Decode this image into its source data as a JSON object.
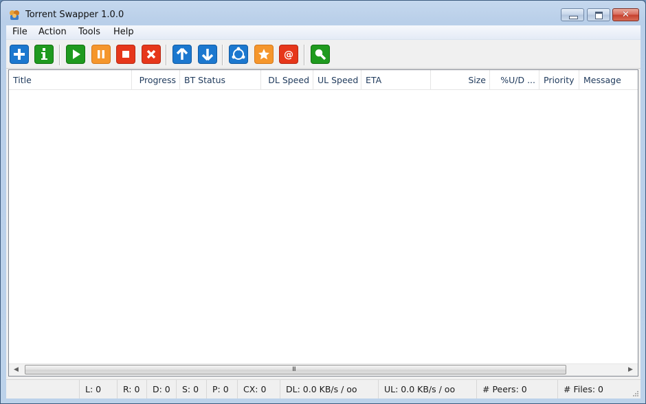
{
  "window": {
    "title": "Torrent Swapper 1.0.0",
    "controls": {
      "minimize": "minimize",
      "maximize": "maximize",
      "close": "✕"
    }
  },
  "menu": [
    {
      "label": "File"
    },
    {
      "label": "Action"
    },
    {
      "label": "Tools"
    },
    {
      "label": "Help"
    }
  ],
  "toolbar": {
    "buttons": [
      {
        "name": "add-torrent",
        "icon": "plus-icon",
        "color": "#1c78cf"
      },
      {
        "name": "info",
        "icon": "info-icon",
        "color": "#1f9a1f"
      },
      {
        "name": "start",
        "icon": "play-icon",
        "color": "#1f9a1f"
      },
      {
        "name": "pause",
        "icon": "pause-icon",
        "color": "#f5962c"
      },
      {
        "name": "stop",
        "icon": "stop-icon",
        "color": "#e6371b"
      },
      {
        "name": "remove",
        "icon": "x-icon",
        "color": "#e6371b"
      },
      {
        "name": "move-up",
        "icon": "arrow-up-icon",
        "color": "#1c78cf"
      },
      {
        "name": "move-down",
        "icon": "arrow-down-icon",
        "color": "#1c78cf"
      },
      {
        "name": "share",
        "icon": "share-icon",
        "color": "#1c78cf"
      },
      {
        "name": "favorite",
        "icon": "star-icon",
        "color": "#f5962c"
      },
      {
        "name": "email",
        "icon": "at-icon",
        "color": "#e6371b"
      },
      {
        "name": "search",
        "icon": "search-icon",
        "color": "#1f9a1f"
      }
    ]
  },
  "list": {
    "columns": [
      {
        "label": "Title",
        "align": "left"
      },
      {
        "label": "Progress",
        "align": "right"
      },
      {
        "label": "BT Status",
        "align": "left"
      },
      {
        "label": "DL Speed",
        "align": "right"
      },
      {
        "label": "UL Speed",
        "align": "right"
      },
      {
        "label": "ETA",
        "align": "left"
      },
      {
        "label": "Size",
        "align": "right"
      },
      {
        "label": "%U/D ...",
        "align": "right"
      },
      {
        "label": "Priority",
        "align": "left"
      },
      {
        "label": "Message",
        "align": "left"
      }
    ],
    "rows": [],
    "scrollbar_grip": "III"
  },
  "statusbar": {
    "cells": [
      {
        "label": ""
      },
      {
        "label": "L: 0"
      },
      {
        "label": "R: 0"
      },
      {
        "label": "D: 0"
      },
      {
        "label": "S: 0"
      },
      {
        "label": "P: 0"
      },
      {
        "label": "CX: 0"
      },
      {
        "label": "DL: 0.0 KB/s / oo"
      },
      {
        "label": "UL: 0.0 KB/s / oo"
      },
      {
        "label": "# Peers: 0"
      },
      {
        "label": "# Files: 0"
      }
    ]
  }
}
